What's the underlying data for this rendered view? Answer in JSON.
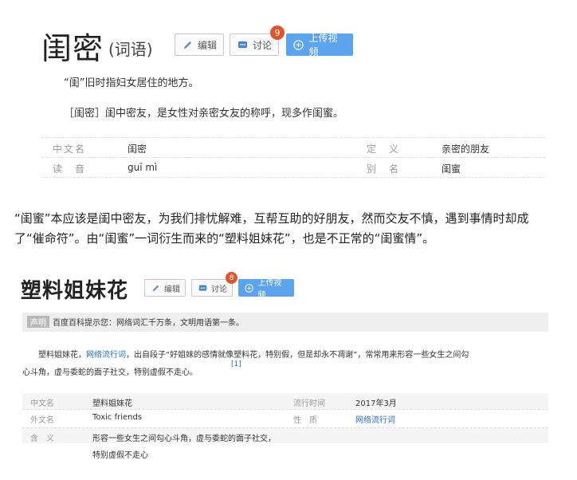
{
  "entry1": {
    "title": "闺密",
    "subtitle": "(词语)",
    "edit_label": "编辑",
    "discuss_label": "讨论",
    "discuss_count": "9",
    "upload_label": "上传视频",
    "def1": "“闺”旧时指妇女居住的地方。",
    "def2": "［闺密］闺中密友，是女性对亲密女友的称呼，现多作闺蜜。",
    "info": [
      {
        "label1": "中文名",
        "val1": "闺密",
        "label2": "定　义",
        "val2": "亲密的朋友"
      },
      {
        "label1": "读　音",
        "val1": "guī mì",
        "label2": "别　名",
        "val2": "闺蜜"
      }
    ]
  },
  "article": {
    "line1": "“闺蜜”本应该是闺中密友，为我们排忧解难，互帮互助的好朋友，然而交友不慎，遇到事情时却成",
    "line2": "了“催命符”。由“闺蜜”一词衍生而来的“塑料姐妹花”，也是不正常的“闺蜜情”。"
  },
  "entry2": {
    "title": "塑料姐妹花",
    "edit_label": "编辑",
    "discuss_label": "讨论",
    "discuss_count": "8",
    "upload_label": "上传视频",
    "notice_tag": "声明",
    "notice_text": "百度百科提示您：网络词汇千万条，文明用语第一条。",
    "desc_part1": "塑料姐妹花，",
    "desc_link": "网络流行词",
    "desc_part2": "，出自段子“好姐妹的感情就像塑料花，特别假，但是却永不凋谢”，常常用来形容一些女生之间勾",
    "desc_line2": "心斗角，虚与委蛇的面子社交，特别虚假不走心。",
    "desc_ref": "[1]",
    "info": {
      "cn_name_label": "中文名",
      "cn_name": "塑料姐妹花",
      "time_label": "流行时间",
      "time": "2017年3月",
      "en_name_label": "外文名",
      "en_name": "Toxic friends",
      "nature_label": "性　质",
      "nature": "网络流行词",
      "meaning_label": "含　义",
      "meaning1": "形容一些女生之间勾心斗角，虚与委蛇的面子社交，",
      "meaning2": "特别虚假不走心"
    }
  },
  "colors": {
    "accent_blue": "#5ba3ec",
    "badge_red": "#e0542c",
    "link_blue": "#2b6fc2"
  }
}
